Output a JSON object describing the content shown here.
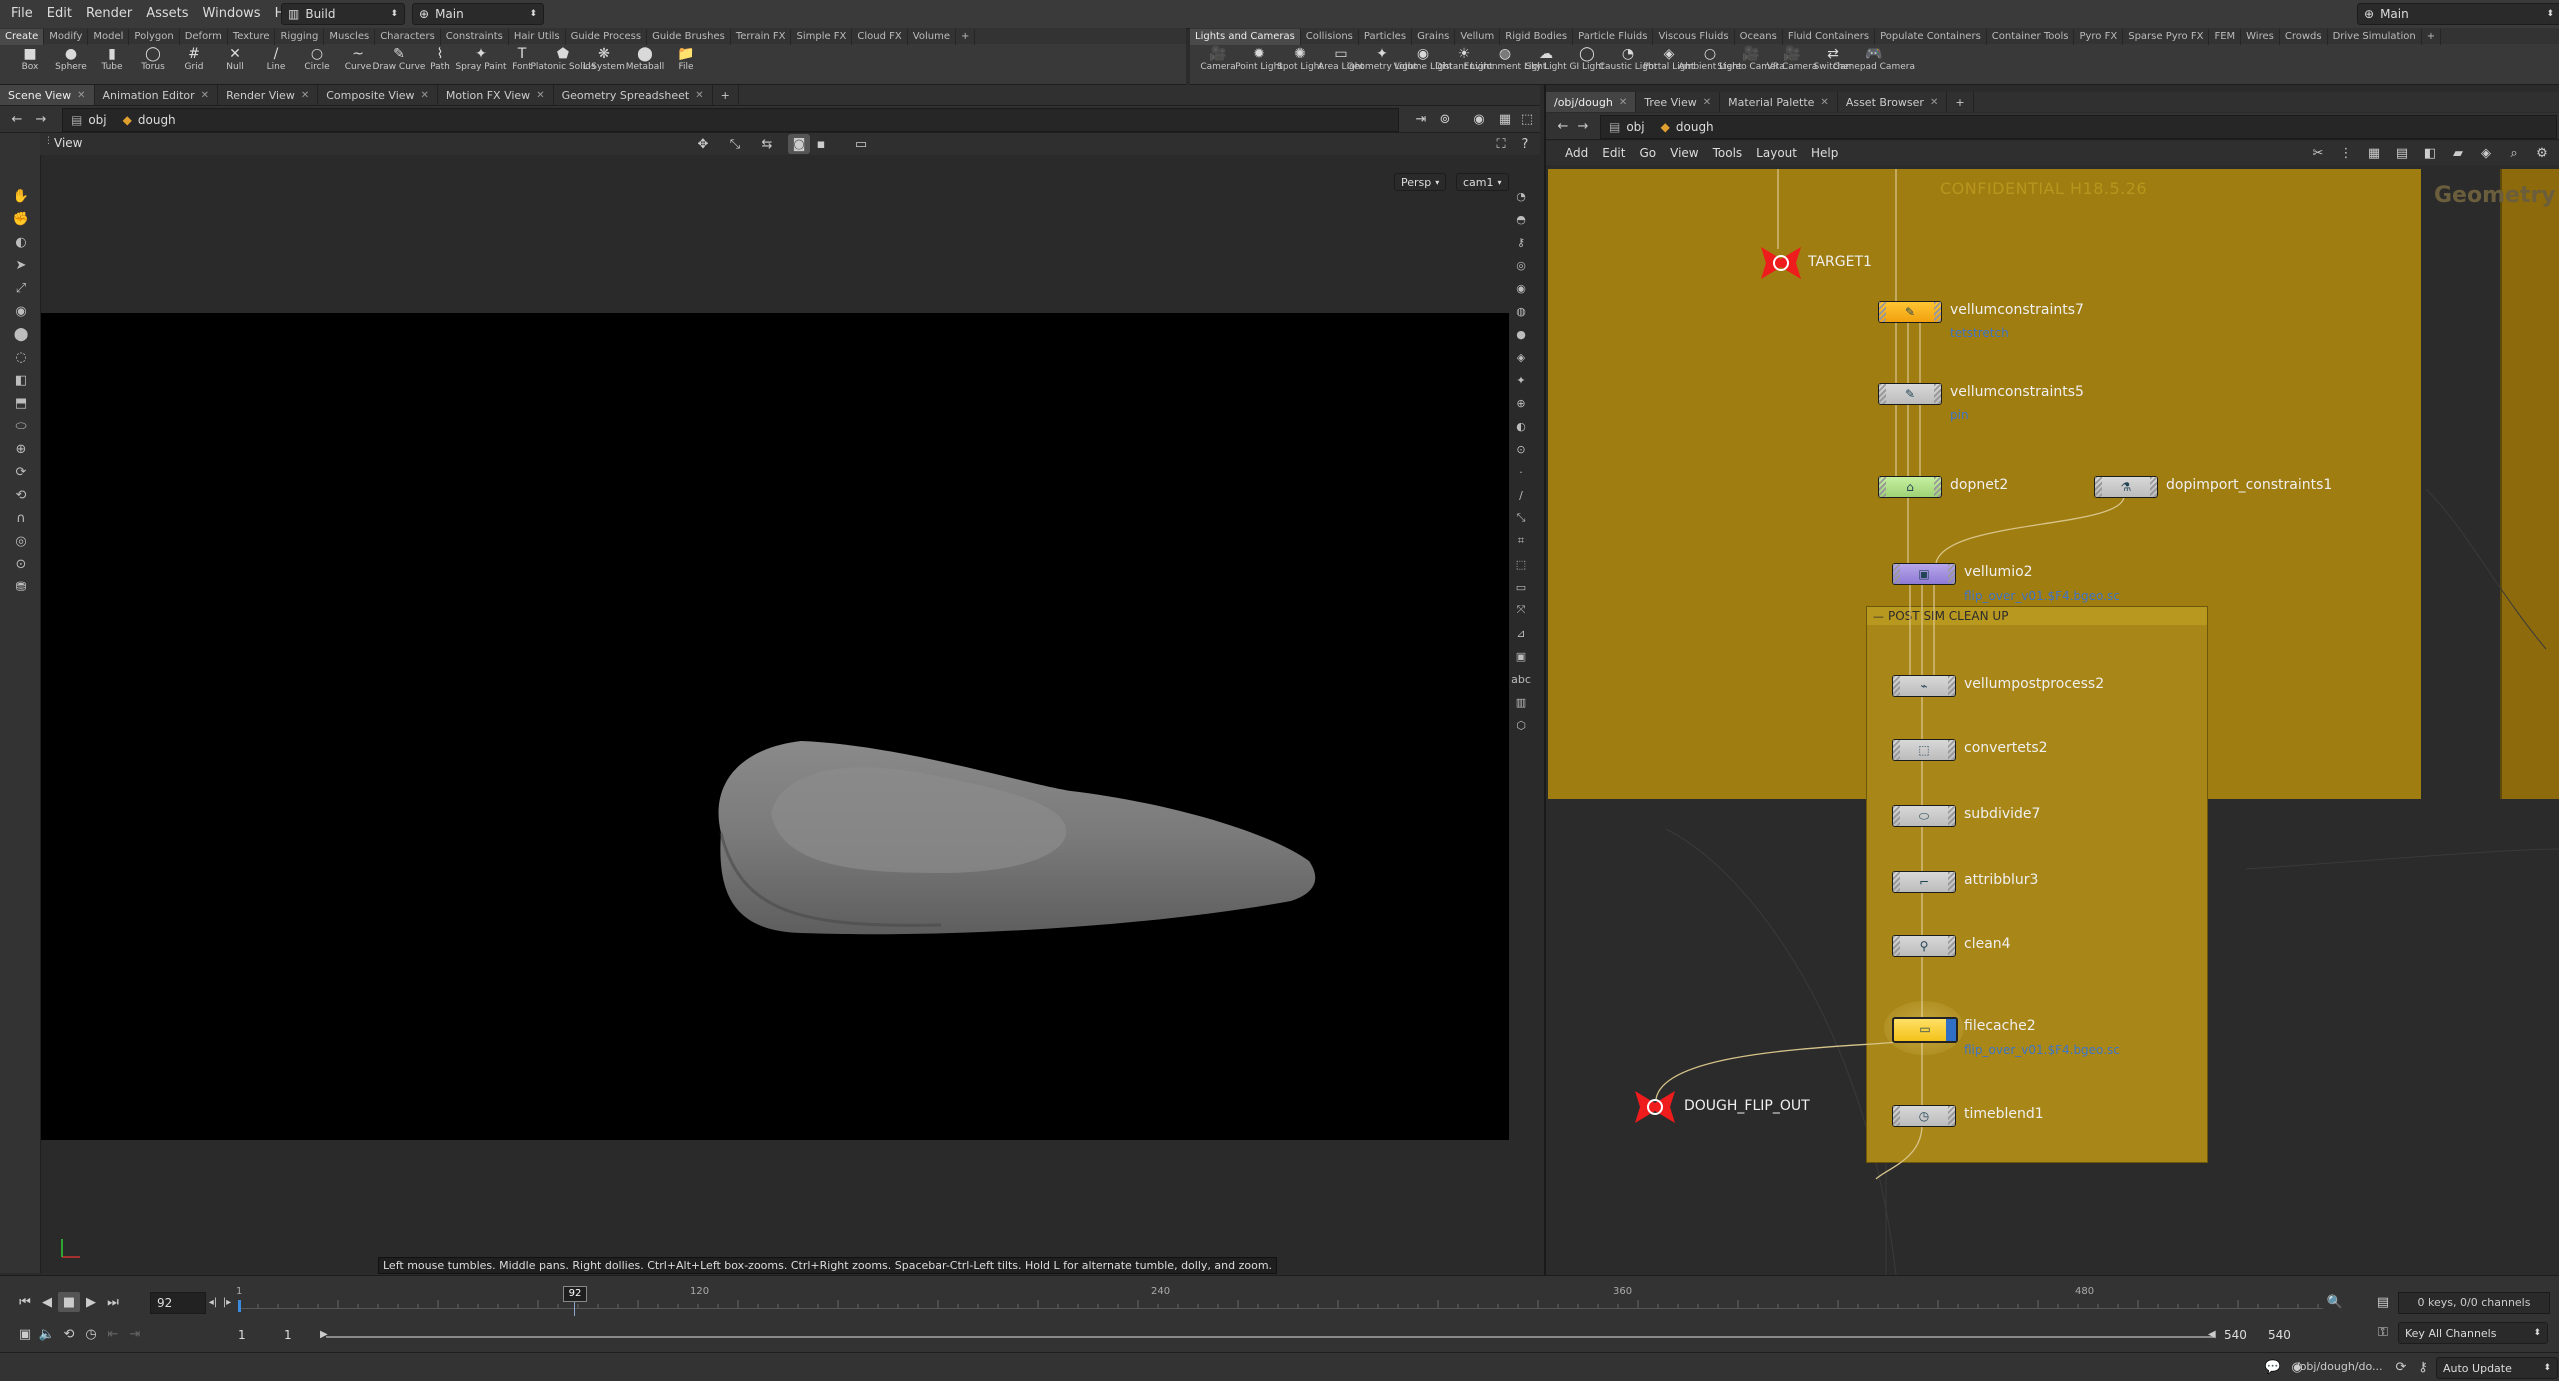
{
  "menubar": {
    "items": [
      "File",
      "Edit",
      "Render",
      "Assets",
      "Windows",
      "Help"
    ],
    "desktop": "Build",
    "context": "Main",
    "right_desktop": "Main"
  },
  "shelf_left": {
    "tabs": [
      "Create",
      "Modify",
      "Model",
      "Polygon",
      "Deform",
      "Texture",
      "Rigging",
      "Muscles",
      "Characters",
      "Constraints",
      "Hair Utils",
      "Guide Process",
      "Guide Brushes",
      "Terrain FX",
      "Simple FX",
      "Cloud FX",
      "Volume"
    ],
    "tools": [
      "Box",
      "Sphere",
      "Tube",
      "Torus",
      "Grid",
      "Null",
      "Line",
      "Circle",
      "Curve",
      "Draw Curve",
      "Path",
      "Spray Paint",
      "Font",
      "Platonic Solids",
      "L-System",
      "Metaball",
      "File"
    ],
    "tool_icons": [
      "■",
      "●",
      "▮",
      "◯",
      "#",
      "✕",
      "/",
      "○",
      "~",
      "✎",
      "⌇",
      "✦",
      "T",
      "⬟",
      "❋",
      "⬤",
      "📁"
    ]
  },
  "shelf_right": {
    "tabs": [
      "Lights and Cameras",
      "Collisions",
      "Particles",
      "Grains",
      "Vellum",
      "Rigid Bodies",
      "Particle Fluids",
      "Viscous Fluids",
      "Oceans",
      "Fluid Containers",
      "Populate Containers",
      "Container Tools",
      "Pyro FX",
      "Sparse Pyro FX",
      "FEM",
      "Wires",
      "Crowds",
      "Drive Simulation"
    ],
    "tools": [
      "Camera",
      "Point Light",
      "Spot Light",
      "Area Light",
      "Geometry Light",
      "Volume Light",
      "Distant Light",
      "Environment Light",
      "Sky Light",
      "GI Light",
      "Caustic Light",
      "Portal Light",
      "Ambient Light",
      "Stereo Camera",
      "VR Camera",
      "Switcher",
      "Gamepad Camera"
    ],
    "tool_icons": [
      "🎥",
      "✹",
      "✺",
      "▭",
      "✦",
      "◉",
      "☀",
      "◍",
      "☁",
      "◯",
      "◔",
      "◈",
      "○",
      "🎥",
      "🎥",
      "⇄",
      "🎮"
    ]
  },
  "left_panel": {
    "tabs": [
      "Scene View",
      "Animation Editor",
      "Render View",
      "Composite View",
      "Motion FX View",
      "Geometry Spreadsheet"
    ],
    "path": [
      "obj",
      "dough"
    ],
    "view_label": "View",
    "persp": "Persp",
    "camera": "cam1",
    "hint": "Left mouse tumbles. Middle pans. Right dollies. Ctrl+Alt+Left box-zooms. Ctrl+Right zooms. Spacebar-Ctrl-Left tilts. Hold L for alternate tumble, dolly, and zoom."
  },
  "right_panel": {
    "tabs": [
      "/obj/dough",
      "Tree View",
      "Material Palette",
      "Asset Browser"
    ],
    "path": [
      "obj",
      "dough"
    ],
    "menu": [
      "Add",
      "Edit",
      "Go",
      "View",
      "Tools",
      "Layout",
      "Help"
    ],
    "watermark": "CONFIDENTIAL H18.5.26",
    "context_label": "Geometry",
    "netbox_title": "POST SIM CLEAN UP",
    "nodes": {
      "target": "TARGET1",
      "vc7": "vellumconstraints7",
      "vc7_sub": "tetstretch",
      "vc5": "vellumconstraints5",
      "vc5_sub": "pin",
      "dopnet": "dopnet2",
      "dopimport": "dopimport_constraints1",
      "vellumio": "vellumio2",
      "vellumio_sub": "flip_over_v01.$F4.bgeo.sc",
      "vpp": "vellumpostprocess2",
      "convert": "convertets2",
      "subdiv": "subdivide7",
      "blur": "attribblur3",
      "clean": "clean4",
      "filecache": "filecache2",
      "filecache_sub": "flip_over_v01.$F4.bgeo.sc",
      "out": "DOUGH_FLIP_OUT",
      "timeblend": "timeblend1"
    }
  },
  "timeline": {
    "frame": "92",
    "marker": "92",
    "ticks": [
      "1",
      "120",
      "240",
      "360",
      "480"
    ],
    "start": "1",
    "start2": "1",
    "end": "540",
    "end2": "540",
    "keys": "0 keys, 0/0 channels",
    "key_mode": "Key All Channels",
    "status_path": "/obj/dough/do...",
    "update_mode": "Auto Update"
  },
  "colors": {
    "netbox": "#a07d10",
    "netbox_inner": "#a88718",
    "node_blue": "#3d74c9"
  }
}
